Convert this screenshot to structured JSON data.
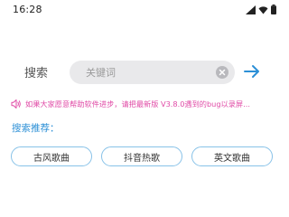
{
  "status_bar": {
    "time": "16:28",
    "icons": [
      "signal-icon",
      "wifi-icon",
      "battery-icon"
    ]
  },
  "search": {
    "label": "搜索",
    "placeholder": "关键词",
    "value": "",
    "clear_icon": "clear-icon",
    "go_icon": "arrow-right-icon"
  },
  "notice": {
    "icon": "speaker-icon",
    "text": "如果大家愿意帮助软件进步，请把最新版 V3.8.0遇到的bug以录屏..."
  },
  "recommend": {
    "label": "搜索推荐：",
    "chips": [
      "古风歌曲",
      "抖音热歌",
      "英文歌曲"
    ]
  },
  "colors": {
    "accent": "#2b8fd6",
    "notice": "#e04aa6",
    "chip_border": "#88c2e8",
    "search_bg": "#e9e9eb"
  }
}
